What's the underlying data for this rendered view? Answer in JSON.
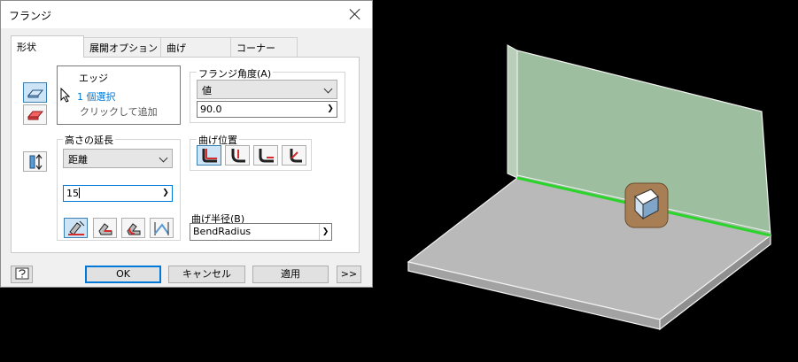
{
  "dialog": {
    "title": "フランジ",
    "tabs": [
      {
        "label": "形状"
      },
      {
        "label": "展開オプション"
      },
      {
        "label": "曲げ"
      },
      {
        "label": "コーナー"
      }
    ],
    "edge_select": {
      "heading": "エッジ",
      "count_text": "1 個選択",
      "hint": "クリックして追加"
    },
    "flange_angle": {
      "label": "フランジ角度(A)",
      "mode": "値",
      "value": "90.0"
    },
    "height_extent": {
      "label": "高さの延長",
      "mode": "距離",
      "value": "15"
    },
    "bend_position": {
      "label": "曲げ位置"
    },
    "bend_radius": {
      "label": "曲げ半径(B)",
      "value": "BendRadius"
    },
    "buttons": {
      "ok": "OK",
      "cancel": "キャンセル",
      "apply": "適用",
      "more": ">>"
    }
  },
  "colors": {
    "accent": "#0078d7",
    "link_text": "#0078d7",
    "selection_highlight": "#2bd42b",
    "flange_face": "#9dbf9f",
    "base_plate": "#b9b9b9",
    "manipulator": "#a87e54"
  }
}
